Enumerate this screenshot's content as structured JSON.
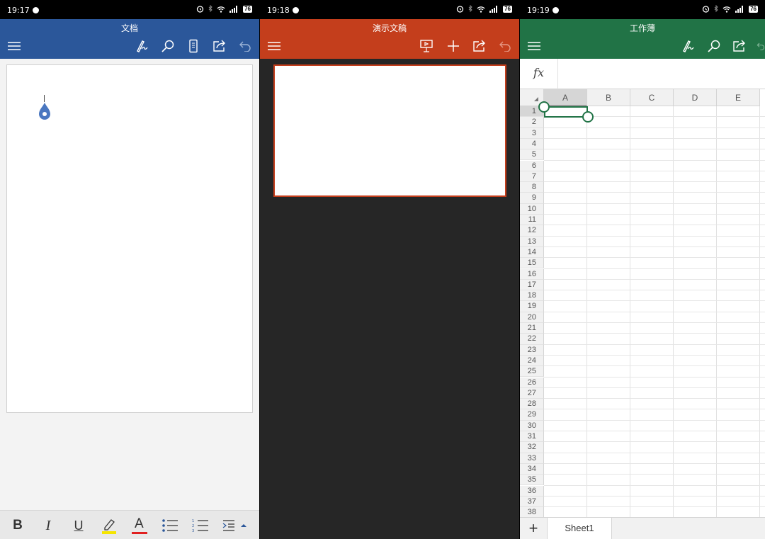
{
  "word": {
    "status_time": "19:17",
    "battery": "76",
    "title": "文档",
    "accent": "#2b579a",
    "toolbar_icons": [
      "menu-icon",
      "draw-icon",
      "search-icon",
      "mobile-view-icon",
      "share-icon",
      "undo-icon"
    ],
    "format_bar": {
      "bold": "B",
      "italic": "I",
      "underline": "U",
      "highlight_color": "#f5e500",
      "font_color_label": "A",
      "font_color": "#e02020"
    }
  },
  "ppt": {
    "status_time": "19:18",
    "battery": "76",
    "title": "演示文稿",
    "accent": "#c43e1c",
    "toolbar_icons": [
      "menu-icon",
      "present-icon",
      "add-icon",
      "share-icon",
      "undo-icon"
    ]
  },
  "excel": {
    "status_time": "19:19",
    "battery": "76",
    "title": "工作薄",
    "accent": "#217346",
    "formula_label": "fx",
    "columns": [
      "A",
      "B",
      "C",
      "D",
      "E"
    ],
    "rows": [
      "1",
      "2",
      "3",
      "4",
      "5",
      "6",
      "7",
      "8",
      "9",
      "10",
      "11",
      "12",
      "13",
      "14",
      "15",
      "16",
      "17",
      "18",
      "19",
      "20",
      "21",
      "22",
      "23",
      "24",
      "25",
      "26",
      "27",
      "28",
      "29",
      "30",
      "31",
      "32",
      "33",
      "34",
      "35",
      "36",
      "37",
      "38"
    ],
    "selected_cell": "A1",
    "add_sheet_label": "+",
    "sheet_tab": "Sheet1"
  }
}
